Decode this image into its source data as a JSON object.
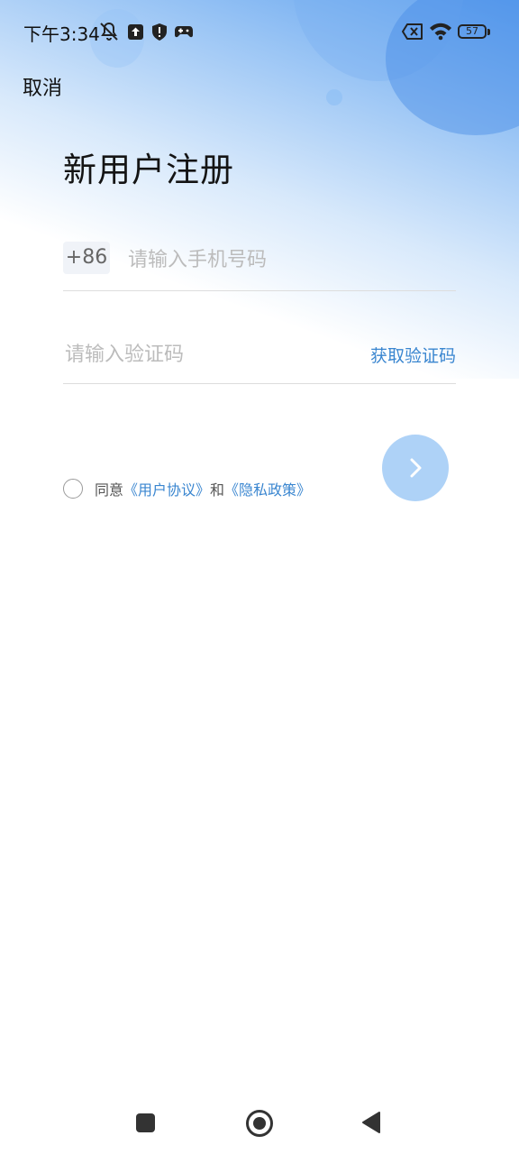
{
  "status_bar": {
    "time": "下午3:34",
    "battery": "57",
    "icons": [
      "notifications-off-icon",
      "upload-icon",
      "shield-icon",
      "gamepad-icon",
      "no-sim-icon",
      "wifi-icon",
      "battery-icon"
    ]
  },
  "header": {
    "cancel_label": "取消",
    "title": "新用户注册"
  },
  "form": {
    "country_code": "+86",
    "phone_placeholder": "请输入手机号码",
    "phone_value": "",
    "code_placeholder": "请输入验证码",
    "code_value": "",
    "get_code_label": "获取验证码"
  },
  "agreement": {
    "checked": false,
    "prefix": "同意",
    "user_agreement": "《用户协议》",
    "and": "和",
    "privacy_policy": "《隐私政策》"
  },
  "next_button": {
    "icon": "chevron-right-icon",
    "enabled": false
  },
  "colors": {
    "accent": "#3a86d0",
    "next_button_disabled": "#aed2f7",
    "gradient_top": "#5fa1ee"
  },
  "nav_bar": {
    "icons": [
      "recents-square-icon",
      "home-circle-icon",
      "back-triangle-icon"
    ]
  }
}
